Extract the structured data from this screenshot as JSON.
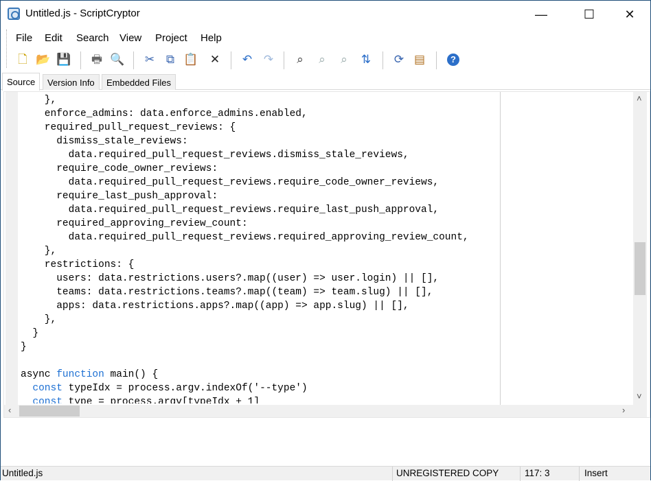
{
  "window": {
    "title": "Untitled.js - ScriptCryptor",
    "minimize": "—",
    "maximize": "☐",
    "close": "✕"
  },
  "menu": [
    "File",
    "Edit",
    "Search",
    "View",
    "Project",
    "Help"
  ],
  "toolbar": [
    {
      "name": "new-file-icon",
      "glyph": "🗋",
      "color": "#c9a000"
    },
    {
      "name": "open-folder-icon",
      "glyph": "📂",
      "color": "#d99a20"
    },
    {
      "name": "save-icon",
      "glyph": "💾",
      "color": "#3a4fa0"
    },
    {
      "name": "print-icon",
      "glyph": "🖶",
      "color": "#666"
    },
    {
      "name": "print-preview-icon",
      "glyph": "🔍",
      "color": "#777"
    },
    {
      "name": "cut-icon",
      "glyph": "✂",
      "color": "#3a66b0"
    },
    {
      "name": "copy-icon",
      "glyph": "⧉",
      "color": "#3a66b0"
    },
    {
      "name": "paste-icon",
      "glyph": "📋",
      "color": "#b07020"
    },
    {
      "name": "delete-icon",
      "glyph": "✕",
      "color": "#222"
    },
    {
      "name": "undo-icon",
      "glyph": "↶",
      "color": "#2c6fc9"
    },
    {
      "name": "redo-icon",
      "glyph": "↷",
      "color": "#9fb9dc"
    },
    {
      "name": "find-icon",
      "glyph": "⌕",
      "color": "#333"
    },
    {
      "name": "find-next-icon",
      "glyph": "⌕",
      "color": "#9aa"
    },
    {
      "name": "find-previous-icon",
      "glyph": "⌕",
      "color": "#9aa"
    },
    {
      "name": "replace-icon",
      "glyph": "⇅",
      "color": "#2c6fc9"
    },
    {
      "name": "compile-icon",
      "glyph": "⟳",
      "color": "#3a66b0"
    },
    {
      "name": "settings-icon",
      "glyph": "▤",
      "color": "#b07020"
    },
    {
      "name": "help-icon",
      "glyph": "?",
      "color": "#fff"
    }
  ],
  "tabs": [
    "Source",
    "Version Info",
    "Embedded Files"
  ],
  "code": [
    [
      [
        "    },",
        ""
      ]
    ],
    [
      [
        "    enforce_admins: data.enforce_admins.enabled,",
        ""
      ]
    ],
    [
      [
        "    required_pull_request_reviews: {",
        ""
      ]
    ],
    [
      [
        "      dismiss_stale_reviews:",
        ""
      ]
    ],
    [
      [
        "        data.required_pull_request_reviews.dismiss_stale_reviews,",
        ""
      ]
    ],
    [
      [
        "      require_code_owner_reviews:",
        ""
      ]
    ],
    [
      [
        "        data.required_pull_request_reviews.require_code_owner_reviews,",
        ""
      ]
    ],
    [
      [
        "      require_last_push_approval:",
        ""
      ]
    ],
    [
      [
        "        data.required_pull_request_reviews.require_last_push_approval,",
        ""
      ]
    ],
    [
      [
        "      required_approving_review_count:",
        ""
      ]
    ],
    [
      [
        "        data.required_pull_request_reviews.required_approving_review_count,",
        ""
      ]
    ],
    [
      [
        "    },",
        ""
      ]
    ],
    [
      [
        "    restrictions: {",
        ""
      ]
    ],
    [
      [
        "      users: data.restrictions.users?.map((user) => user.login) || [],",
        ""
      ]
    ],
    [
      [
        "      teams: data.restrictions.teams?.map((team) => team.slug) || [],",
        ""
      ]
    ],
    [
      [
        "      apps: data.restrictions.apps?.map((app) => app.slug) || [],",
        ""
      ]
    ],
    [
      [
        "    },",
        ""
      ]
    ],
    [
      [
        "  }",
        ""
      ]
    ],
    [
      [
        "}",
        ""
      ]
    ],
    [
      [
        "",
        ""
      ]
    ],
    [
      [
        "async ",
        ""
      ],
      [
        "function",
        "kw"
      ],
      [
        " main() {",
        ""
      ]
    ],
    [
      [
        "  ",
        ""
      ],
      [
        "const",
        "kw"
      ],
      [
        " typeIdx = process.argv.indexOf('--type')",
        ""
      ]
    ],
    [
      [
        "  ",
        ""
      ],
      [
        "const",
        "kw"
      ],
      [
        " type = process.argv[typeIdx + 1]",
        ""
      ]
    ]
  ],
  "statusbar": {
    "file": "Untitled.js",
    "registration": "UNREGISTERED COPY",
    "position": "117: 3",
    "mode": "Insert"
  }
}
